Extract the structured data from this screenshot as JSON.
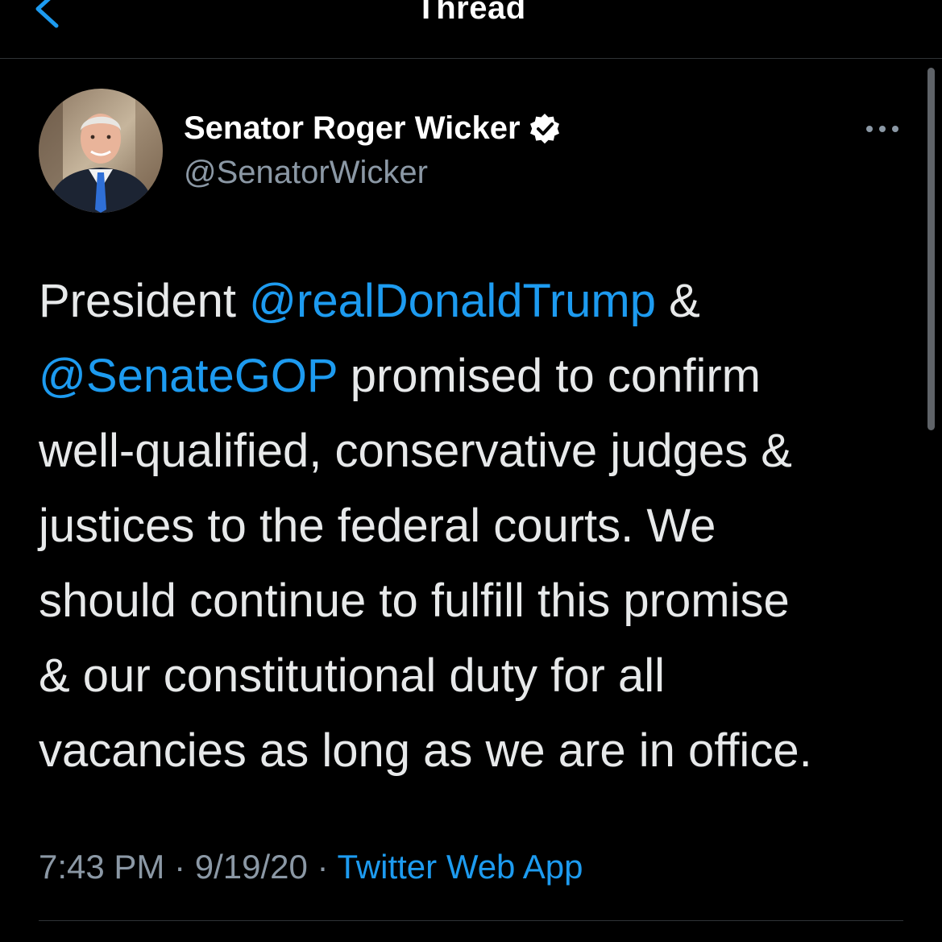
{
  "header": {
    "title": "Thread",
    "back_icon": "chevron-left-icon"
  },
  "tweet": {
    "author": {
      "display_name": "Senator Roger Wicker",
      "handle": "@SenatorWicker",
      "verified": true,
      "avatar_icon": "profile-photo"
    },
    "more_icon": "more-horizontal-icon",
    "text_lines": [
      [
        {
          "text": "President ",
          "type": "text"
        },
        {
          "text": "@realDonaldTrump",
          "type": "mention"
        },
        {
          "text": " &",
          "type": "text"
        }
      ],
      [
        {
          "text": "@SenateGOP",
          "type": "mention"
        },
        {
          "text": " promised to confirm",
          "type": "text"
        }
      ],
      [
        {
          "text": "well-qualified, conservative judges &",
          "type": "text"
        }
      ],
      [
        {
          "text": "justices to the federal courts. We",
          "type": "text"
        }
      ],
      [
        {
          "text": "should continue to fulfill this promise",
          "type": "text"
        }
      ],
      [
        {
          "text": "& our constitutional duty for all",
          "type": "text"
        }
      ],
      [
        {
          "text": "vacancies as long as we are in office.",
          "type": "text"
        }
      ]
    ],
    "time": "7:43 PM",
    "separator": " · ",
    "date": "9/19/20",
    "source": "Twitter Web App"
  },
  "colors": {
    "background": "#000000",
    "text": "#e7e9ea",
    "secondary_text": "#8b98a5",
    "link": "#1d9bf0",
    "divider": "#2f3336"
  }
}
